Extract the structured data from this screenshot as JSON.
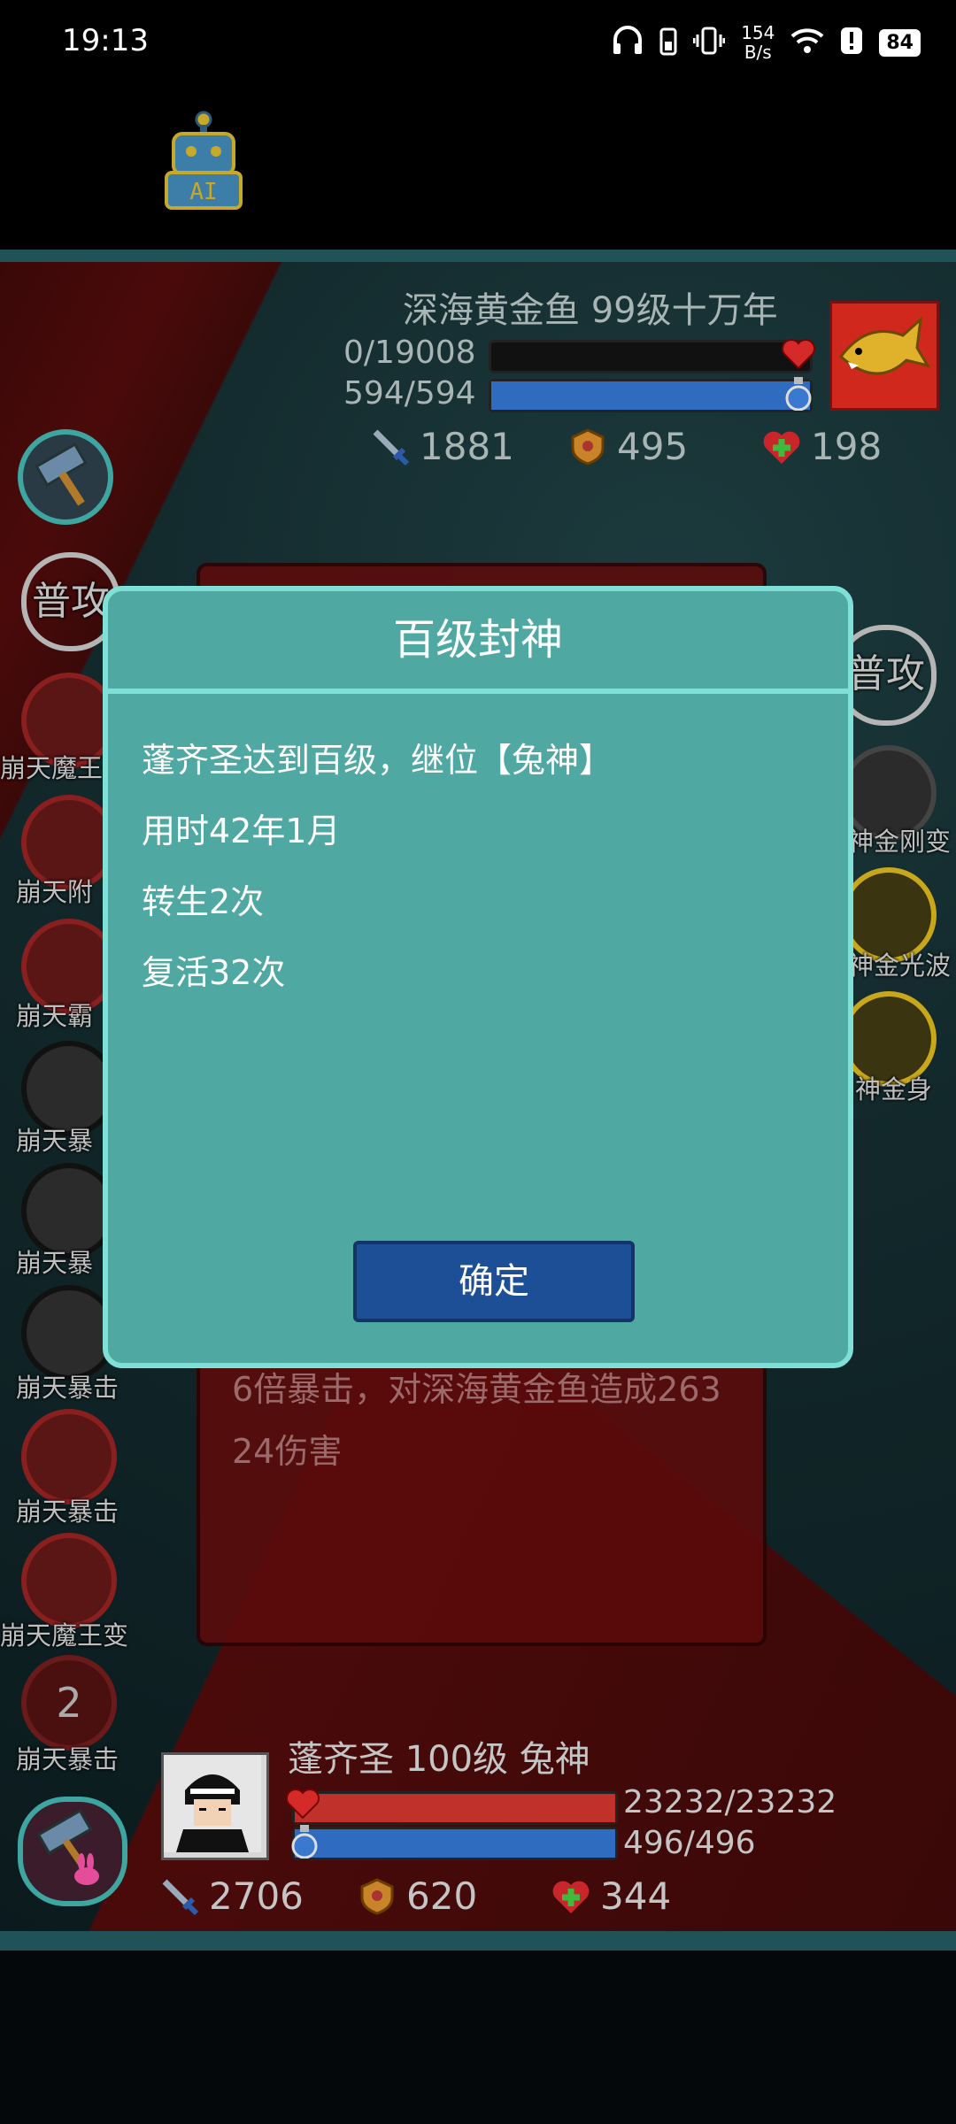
{
  "status_bar": {
    "time": "19:13",
    "net_speed_value": "154",
    "net_speed_unit": "B/s",
    "battery": "84"
  },
  "enemy": {
    "name": "深海黄金鱼 99级十万年",
    "hp_text": "0/19008",
    "hp_fraction": 0.0,
    "mp_text": "594/594",
    "mp_fraction": 1.0,
    "attack": "1881",
    "defense": "495",
    "heal": "198"
  },
  "left_skills": [
    {
      "label": "普攻"
    },
    {
      "label": "崩天魔王"
    },
    {
      "label": "崩天附"
    },
    {
      "label": "崩天霸"
    },
    {
      "label": "崩天暴"
    },
    {
      "label": "崩天暴"
    },
    {
      "label": "崩天暴击"
    },
    {
      "label": "崩天暴击"
    },
    {
      "label": "崩天魔王变"
    },
    {
      "label": "崩天暴击",
      "count": "2"
    }
  ],
  "right_skills": [
    {
      "label": "普攻"
    },
    {
      "label": "神金刚变"
    },
    {
      "label": "神金光波"
    },
    {
      "label": "神金身"
    }
  ],
  "battle_log": {
    "text": "6倍暴击，对深海黄金鱼造成26324伤害"
  },
  "dialog": {
    "title": "百级封神",
    "lines": [
      "蓬齐圣达到百级，继位【兔神】",
      "用时42年1月",
      "转生2次",
      "复活32次"
    ],
    "confirm_label": "确定"
  },
  "player": {
    "name": "蓬齐圣 100级 兔神",
    "hp_text": "23232/23232",
    "hp_fraction": 1.0,
    "mp_text": "496/496",
    "mp_fraction": 1.0,
    "attack": "2706",
    "defense": "620",
    "heal": "344"
  },
  "colors": {
    "hp_bar": "#c0312b",
    "mp_bar": "#2f6cc0",
    "dialog_bg": "#4fa8a1",
    "dialog_border": "#7ee0d7",
    "button": "#1d4f97"
  }
}
